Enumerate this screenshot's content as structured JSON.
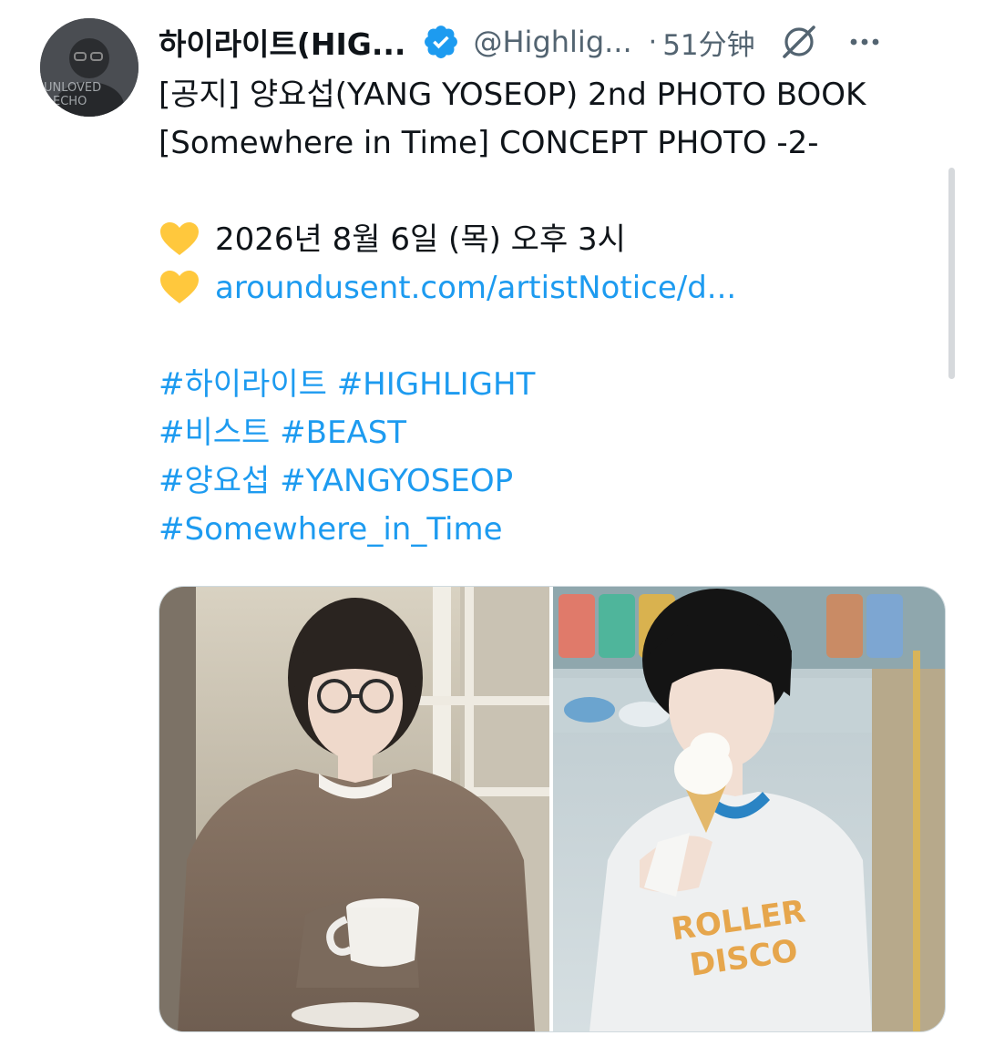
{
  "tweet": {
    "author": {
      "display_name": "하이라이트(HIG...",
      "handle": "@Highlig...",
      "verified": true,
      "avatar_icon": "avatar-image"
    },
    "separator": "·",
    "timestamp": "51分钟",
    "text": {
      "line1": "[공지] 양요섭(YANG YOSEOP) 2nd PHOTO BOOK",
      "line2": "[Somewhere in Time] CONCEPT PHOTO -2-",
      "date_line": "2026년 8월 6일 (목) 오후 3시",
      "link": "aroundusent.com/artistNotice/d...",
      "heart_icon": "yellow-heart-icon",
      "heart_color": "#ffc83d"
    },
    "hashtags": [
      "#하이라이트 #HIGHLIGHT",
      "#비스트 #BEAST",
      "#양요섭 #YANGYOSEOP",
      "#Somewhere_in_Time"
    ],
    "media": {
      "count": 2,
      "items": [
        {
          "description_icon": "photo-sweater-mug"
        },
        {
          "description_icon": "photo-ice-cream"
        }
      ]
    }
  },
  "colors": {
    "link_blue": "#1d9bf0",
    "verified_blue": "#1d9bf0",
    "secondary_text": "#536471",
    "primary_text": "#0f1419"
  }
}
